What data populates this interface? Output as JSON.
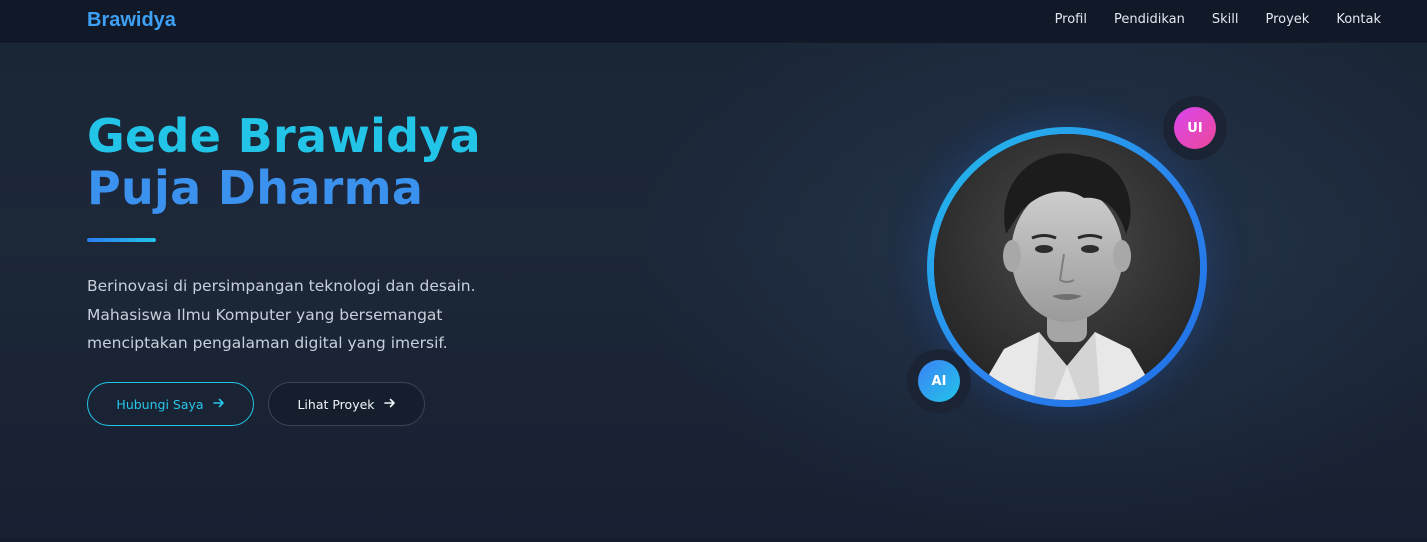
{
  "header": {
    "brand": "Brawidya",
    "nav": [
      "Profil",
      "Pendidikan",
      "Skill",
      "Proyek",
      "Kontak"
    ]
  },
  "hero": {
    "title_line1": "Gede Brawidya",
    "title_line2": "Puja Dharma",
    "description_lines": [
      "Berinovasi di persimpangan teknologi dan desain.",
      "Mahasiswa Ilmu Komputer yang bersemangat",
      "menciptakan pengalaman digital yang imersif."
    ],
    "primary_button": "Hubungi Saya",
    "secondary_button": "Lihat Proyek",
    "arrow_icon": "arrow-right-icon"
  },
  "profile": {
    "badge_top": "UI",
    "badge_bottom": "AI"
  },
  "colors": {
    "brand": "#3ea0f5",
    "title_cyan": "#22c4e8",
    "title_blue": "#3b92ee",
    "badge_ui": "#d946ef",
    "badge_ai": "#3b82f6"
  }
}
